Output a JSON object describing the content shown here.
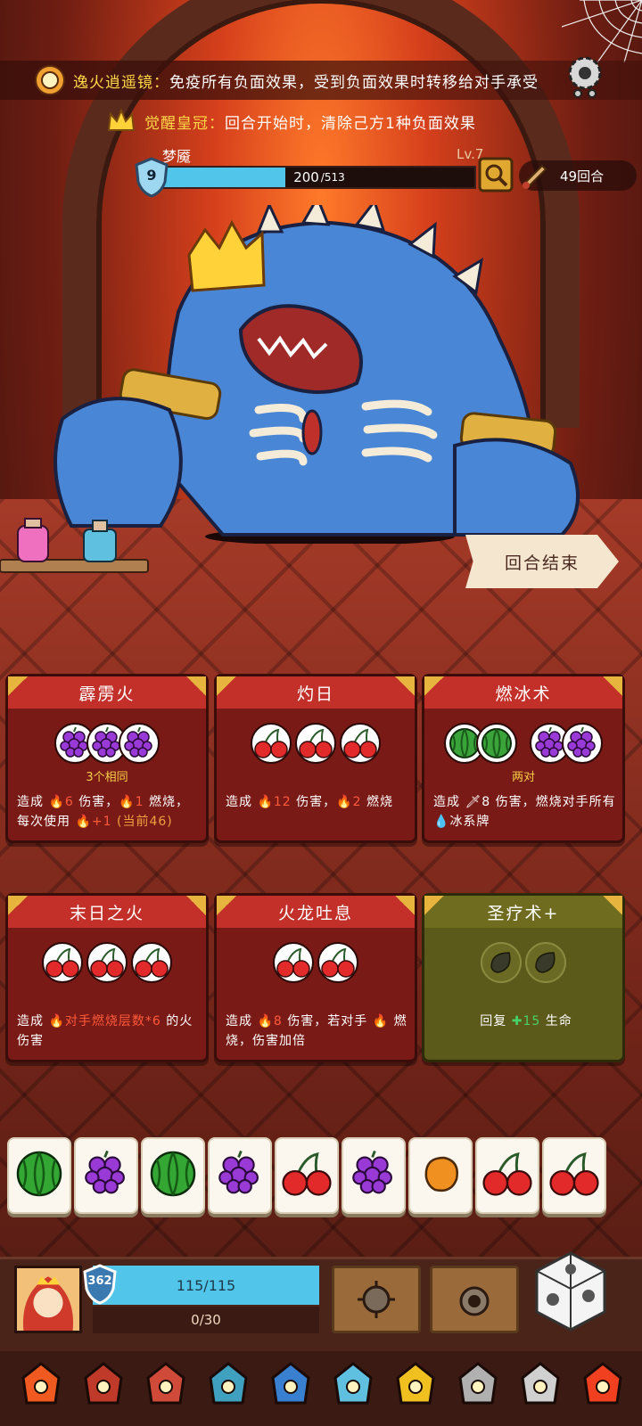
{
  "buffs": [
    {
      "name": "逸火逍遥镜：",
      "text": "免疫所有负面效果，受到负面效果时转移给对手承受",
      "icon": "mirror-icon"
    },
    {
      "name": "觉醒皇冠：",
      "text": "回合开始时，清除己方1种负面效果",
      "icon": "crown-icon"
    }
  ],
  "enemy": {
    "name": "梦魇",
    "level": "Lv.7",
    "shield": "9",
    "hp_current": "200",
    "hp_max": "/513",
    "hp_fraction": 0.39
  },
  "turns": {
    "label": "49回合"
  },
  "end_turn": {
    "label": "回合结束"
  },
  "cards": [
    {
      "title": "霹雳火",
      "slots": [
        "grape",
        "grape",
        "grape"
      ],
      "condition": "3个相同",
      "desc": [
        {
          "t": "造成 "
        },
        {
          "t": "🔥6",
          "c": "red"
        },
        {
          "t": " 伤害，"
        },
        {
          "t": "🔥1",
          "c": "red"
        },
        {
          "t": " 燃烧，每次使用 "
        },
        {
          "t": "🔥+1",
          "c": "red"
        },
        {
          "t": " (当前46)",
          "c": "orange"
        }
      ]
    },
    {
      "title": "灼日",
      "slots": [
        "cherry",
        "cherry",
        "cherry"
      ],
      "condition": "",
      "desc": [
        {
          "t": "造成 "
        },
        {
          "t": "🔥12",
          "c": "red"
        },
        {
          "t": " 伤害，"
        },
        {
          "t": "🔥2",
          "c": "red"
        },
        {
          "t": " 燃烧"
        }
      ]
    },
    {
      "title": "燃冰术",
      "slots": [
        "melon",
        "melon",
        "grape",
        "grape"
      ],
      "condition": "两对",
      "desc": [
        {
          "t": "造成 "
        },
        {
          "t": "🗡8"
        },
        {
          "t": " 伤害，燃烧对手所有 "
        },
        {
          "t": "💧",
          "c": "blue"
        },
        {
          "t": "冰系牌"
        }
      ]
    },
    {
      "title": "末日之火",
      "slots": [
        "cherry",
        "cherry",
        "cherry"
      ],
      "condition": "",
      "desc": [
        {
          "t": "造成 "
        },
        {
          "t": "🔥对手燃烧层数*6",
          "c": "red"
        },
        {
          "t": " 的火伤害"
        }
      ]
    },
    {
      "title": "火龙吐息",
      "slots": [
        "cherry",
        "cherry"
      ],
      "condition": "",
      "desc": [
        {
          "t": "造成 "
        },
        {
          "t": "🔥8",
          "c": "red"
        },
        {
          "t": " 伤害，若对手 "
        },
        {
          "t": "🔥",
          "c": "red"
        },
        {
          "t": " 燃烧，伤害加倍"
        }
      ]
    },
    {
      "title": "圣疗术+",
      "slots": [
        "seed",
        "seed"
      ],
      "condition": "",
      "desc": [
        {
          "t": "回复 "
        },
        {
          "t": "✚15",
          "c": "green"
        },
        {
          "t": " 生命"
        }
      ]
    }
  ],
  "dice": [
    "watermelon",
    "grape",
    "watermelon",
    "grape",
    "cherry",
    "grape",
    "mango",
    "cherry",
    "cherry"
  ],
  "player": {
    "shield": "362",
    "hp": "115/115",
    "xp": "0/30"
  },
  "relics": [
    "sun-ember-icon",
    "hood-icon",
    "flame-gem-icon",
    "crystal-icon",
    "blue-beast-icon",
    "ghost-icon",
    "crown-icon",
    "iron-helm-icon",
    "spiked-helm-icon",
    "fire-icon"
  ],
  "colors": {
    "card_red": "#c3302a",
    "card_body": "#7a1a16",
    "heal_olive": "#6f6b1f",
    "hp_blue": "#52c6ea",
    "buff_gold": "#ffd84a"
  }
}
